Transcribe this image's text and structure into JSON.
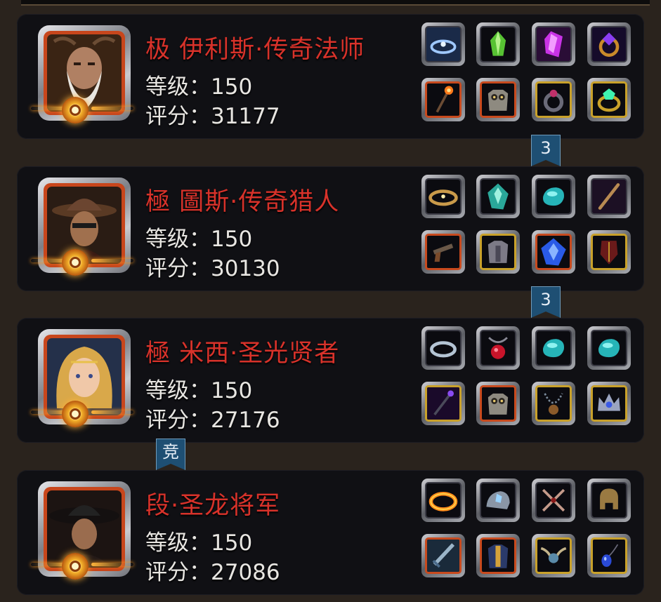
{
  "heroes": [
    {
      "name": "极 伊利斯·传奇法师",
      "level": "等级：150",
      "score": "评分：31177",
      "portrait": "mage-portrait",
      "items": [
        "frost-ring-icon",
        "green-crystal-icon",
        "purple-gem-icon",
        "amethyst-ring-icon",
        "fire-staff-icon",
        "owl-armor-icon",
        "dark-ring-icon",
        "emerald-ring-icon"
      ]
    },
    {
      "name": "極 圖斯·传奇猎人",
      "level": "等级：150",
      "score": "评分：30130",
      "portrait": "hunter-portrait",
      "items": [
        "golden-hoop-icon",
        "teal-gem-icon",
        "cyan-stone-icon",
        "wooden-stick-icon",
        "pistol-icon",
        "steel-armor-icon",
        "blue-gem-icon",
        "crimson-shield-icon"
      ]
    },
    {
      "name": "極 米西·圣光贤者",
      "level": "等级：150",
      "score": "评分：27176",
      "portrait": "sage-portrait",
      "items": [
        "silver-ring-icon",
        "ruby-amulet-icon",
        "cyan-stone-icon",
        "cyan-stone-icon",
        "dark-staff-icon",
        "owl-armor-icon",
        "beaded-necklace-icon",
        "crystal-crown-icon"
      ]
    },
    {
      "name": "段·圣龙将军",
      "level": "等级：150",
      "score": "评分：27086",
      "portrait": "general-portrait",
      "items": [
        "flame-ring-icon",
        "crystal-pauldron-icon",
        "crossed-daggers-icon",
        "bronze-helmet-icon",
        "great-sword-icon",
        "golden-armor-icon",
        "winged-amulet-icon",
        "sapphire-pendant-icon"
      ]
    }
  ],
  "badges": [
    {
      "text": "3"
    },
    {
      "text": "3"
    },
    {
      "text": "竞"
    }
  ],
  "colors": {
    "name_red": "#d8322a",
    "panel_bg": "#101014",
    "page_bg": "#2a231d",
    "frame_orange": "#c84a1e",
    "frame_gold": "#c9a12a",
    "badge_blue": "#1e4f73"
  }
}
